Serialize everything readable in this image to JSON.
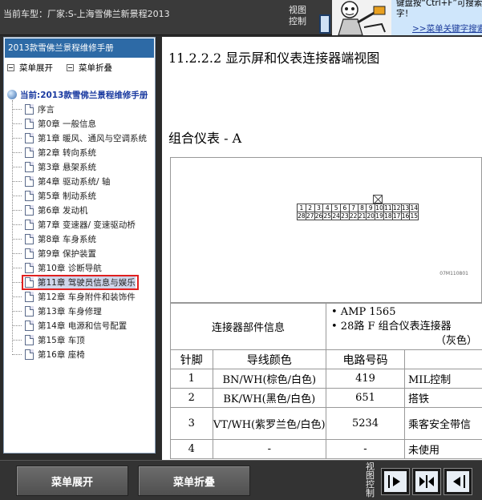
{
  "header": {
    "car_model": "当前车型：厂家:S-上海雪佛兰新景程2013",
    "view_control_label": "视图控制",
    "tip_text": "键盘按“Ctrl+F”可搜索字！",
    "tip_link": ">>菜单关键字搜索"
  },
  "sidebar": {
    "manual_title": "2013款雪佛兰景程维修手册",
    "expand_label": "菜单展开",
    "collapse_label": "菜单折叠",
    "root_label": "当前:2013款雪佛兰景程维修手册",
    "items": [
      {
        "label": "序言"
      },
      {
        "label": "第0章 一般信息"
      },
      {
        "label": "第1章 暖风、通风与空调系统"
      },
      {
        "label": "第2章 转向系统"
      },
      {
        "label": "第3章 悬架系统"
      },
      {
        "label": "第4章 驱动系统/ 轴"
      },
      {
        "label": "第5章 制动系统"
      },
      {
        "label": "第6章 发动机"
      },
      {
        "label": "第7章 变速器/ 变速驱动桥"
      },
      {
        "label": "第8章 车身系统"
      },
      {
        "label": "第9章 保护装置"
      },
      {
        "label": "第10章 诊断导航"
      },
      {
        "label": "第11章 驾驶员信息与娱乐"
      },
      {
        "label": "第12章 车身附件和装饰件"
      },
      {
        "label": "第13章 车身修理"
      },
      {
        "label": "第14章 电源和信号配置"
      },
      {
        "label": "第15章 车顶"
      },
      {
        "label": "第16章 座椅"
      }
    ],
    "selected_index": 12
  },
  "content": {
    "section_heading": "11.2.2.2 显示屏和仪表连接器端视图",
    "sub_heading": "组合仪表 - A",
    "diagram_code": "07M110801",
    "connector_top_row": [
      "1",
      "2",
      "3",
      "4",
      "5",
      "6",
      "7",
      "8",
      "9",
      "10",
      "11",
      "12",
      "13",
      "14"
    ],
    "connector_bottom_row": [
      "28",
      "27",
      "26",
      "25",
      "24",
      "23",
      "22",
      "21",
      "20",
      "19",
      "18",
      "17",
      "16",
      "15"
    ],
    "info_label": "连接器部件信息",
    "info_line1": "• AMP 1565",
    "info_line2": "• 28路 F 组合仪表连接器",
    "info_line3": "（灰色）",
    "table_headers": {
      "pin": "针脚",
      "color": "导线颜色",
      "circuit": "电路号码",
      "function": ""
    },
    "rows": [
      {
        "pin": "1",
        "color": "BN/WH(棕色/白色)",
        "circuit": "419",
        "function": "MIL控制"
      },
      {
        "pin": "2",
        "color": "BK/WH(黑色/白色)",
        "circuit": "651",
        "function": "搭铁"
      },
      {
        "pin": "3",
        "color": "VT/WH(紫罗兰色/白色)",
        "circuit": "5234",
        "function": "乘客安全带信"
      },
      {
        "pin": "4",
        "color": "-",
        "circuit": "-",
        "function": "未使用"
      }
    ]
  },
  "footer": {
    "expand_button": "菜单展开",
    "collapse_button": "菜单折叠",
    "view_control_label": "视图控制"
  },
  "colors": {
    "accent": "#2d6aa6",
    "highlight": "#e02020",
    "tip_bg": "#cfe6fb"
  },
  "icons": [
    "manual-root-icon",
    "document-icon",
    "mascot-pointing",
    "arrow-right-icon",
    "arrows-both-icon",
    "arrow-left-icon"
  ]
}
